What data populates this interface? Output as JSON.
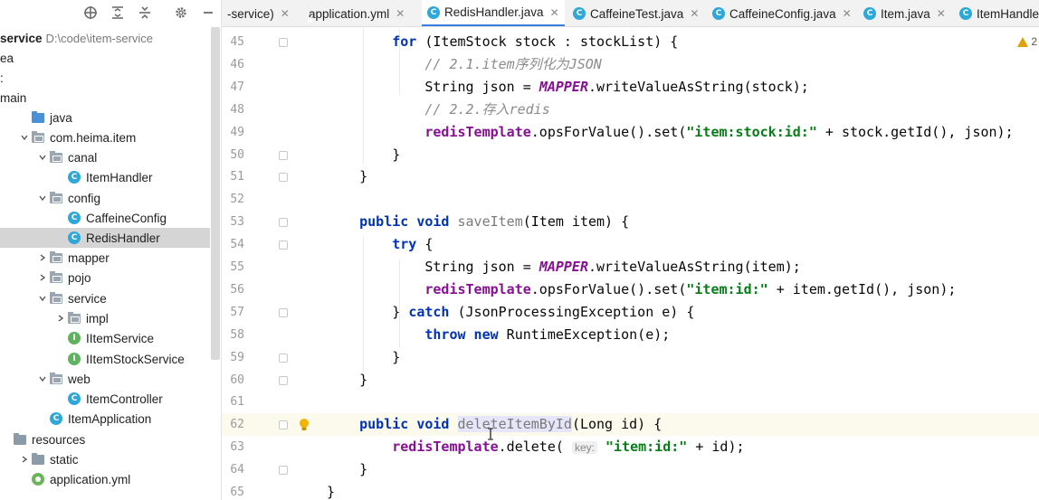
{
  "project": {
    "toolbar_icons": [
      "crosshair-icon",
      "expand-all-icon",
      "collapse-all-icon",
      "gear-icon",
      "hide-icon"
    ],
    "tree": [
      {
        "label": "service",
        "detail": "D:\\code\\item-service",
        "type": "module",
        "indent": 0
      },
      {
        "label": "ea",
        "type": "folder",
        "indent": 0
      },
      {
        "label": ":",
        "type": "text",
        "indent": 0
      },
      {
        "label": "main",
        "type": "folder",
        "indent": 0
      },
      {
        "label": "java",
        "type": "source",
        "indent": 1
      },
      {
        "label": "com.heima.item",
        "type": "package",
        "indent": 1,
        "expanded": true
      },
      {
        "label": "canal",
        "type": "package",
        "indent": 2,
        "expanded": true
      },
      {
        "label": "ItemHandler",
        "type": "class",
        "indent": 3
      },
      {
        "label": "config",
        "type": "package",
        "indent": 2,
        "expanded": true
      },
      {
        "label": "CaffeineConfig",
        "type": "class",
        "indent": 3
      },
      {
        "label": "RedisHandler",
        "type": "class",
        "indent": 3,
        "selected": true
      },
      {
        "label": "mapper",
        "type": "package",
        "indent": 2,
        "expanded": false
      },
      {
        "label": "pojo",
        "type": "package",
        "indent": 2,
        "expanded": false
      },
      {
        "label": "service",
        "type": "package",
        "indent": 2,
        "expanded": true
      },
      {
        "label": "impl",
        "type": "package",
        "indent": 3,
        "expanded": false
      },
      {
        "label": "IItemService",
        "type": "interface",
        "indent": 3
      },
      {
        "label": "IItemStockService",
        "type": "interface",
        "indent": 3
      },
      {
        "label": "web",
        "type": "package",
        "indent": 2,
        "expanded": true
      },
      {
        "label": "ItemController",
        "type": "class",
        "indent": 3
      },
      {
        "label": "ItemApplication",
        "type": "app",
        "indent": 2
      },
      {
        "label": "resources",
        "type": "resources",
        "indent": 0
      },
      {
        "label": "static",
        "type": "folder",
        "indent": 1,
        "expanded": false
      },
      {
        "label": "application.yml",
        "type": "yml",
        "indent": 1
      }
    ]
  },
  "tabs": [
    {
      "label": "-service)",
      "type": "none"
    },
    {
      "label": "application.yml",
      "type": "yml"
    },
    {
      "label": "RedisHandler.java",
      "type": "class",
      "active": true
    },
    {
      "label": "CaffeineTest.java",
      "type": "test"
    },
    {
      "label": "CaffeineConfig.java",
      "type": "class"
    },
    {
      "label": "Item.java",
      "type": "class"
    },
    {
      "label": "ItemHandle",
      "type": "class"
    }
  ],
  "editor": {
    "warning_count": "2",
    "current_line": 62,
    "lines": [
      {
        "num": "45",
        "tokens": [
          [
            "",
            "        "
          ],
          [
            "kw",
            "for"
          ],
          [
            "",
            " (ItemStock stock : stockList) {"
          ]
        ]
      },
      {
        "num": "46",
        "tokens": [
          [
            "",
            "            "
          ],
          [
            "cmt",
            "// 2.1.item序列化为JSON"
          ]
        ]
      },
      {
        "num": "47",
        "tokens": [
          [
            "",
            "            String json = "
          ],
          [
            "const",
            "MAPPER"
          ],
          [
            "",
            ".writeValueAsString(stock);"
          ]
        ]
      },
      {
        "num": "48",
        "tokens": [
          [
            "",
            "            "
          ],
          [
            "cmt",
            "// 2.2.存入redis"
          ]
        ]
      },
      {
        "num": "49",
        "tokens": [
          [
            "",
            "            "
          ],
          [
            "fld",
            "redisTemplate"
          ],
          [
            "",
            ".opsForValue().set("
          ],
          [
            "str",
            "\"item:stock:id:\""
          ],
          [
            "",
            " + stock.getId(), json);"
          ]
        ]
      },
      {
        "num": "50",
        "tokens": [
          [
            "",
            "        }"
          ]
        ]
      },
      {
        "num": "51",
        "tokens": [
          [
            "",
            "    }"
          ]
        ]
      },
      {
        "num": "52",
        "tokens": []
      },
      {
        "num": "53",
        "tokens": [
          [
            "",
            "    "
          ],
          [
            "kw",
            "public void"
          ],
          [
            "",
            " "
          ],
          [
            "unused",
            "saveItem"
          ],
          [
            "",
            "(Item item) {"
          ]
        ]
      },
      {
        "num": "54",
        "tokens": [
          [
            "",
            "        "
          ],
          [
            "kw",
            "try"
          ],
          [
            "",
            " {"
          ]
        ]
      },
      {
        "num": "55",
        "tokens": [
          [
            "",
            "            String json = "
          ],
          [
            "const",
            "MAPPER"
          ],
          [
            "",
            ".writeValueAsString(item);"
          ]
        ]
      },
      {
        "num": "56",
        "tokens": [
          [
            "",
            "            "
          ],
          [
            "fld",
            "redisTemplate"
          ],
          [
            "",
            ".opsForValue().set("
          ],
          [
            "str",
            "\"item:id:\""
          ],
          [
            "",
            " + item.getId(), json);"
          ]
        ]
      },
      {
        "num": "57",
        "tokens": [
          [
            "",
            "        } "
          ],
          [
            "kw",
            "catch"
          ],
          [
            "",
            " (JsonProcessingException e) {"
          ]
        ]
      },
      {
        "num": "58",
        "tokens": [
          [
            "",
            "            "
          ],
          [
            "kw",
            "throw new"
          ],
          [
            "",
            " RuntimeException(e);"
          ]
        ]
      },
      {
        "num": "59",
        "tokens": [
          [
            "",
            "        }"
          ]
        ]
      },
      {
        "num": "60",
        "tokens": [
          [
            "",
            "    }"
          ]
        ]
      },
      {
        "num": "61",
        "tokens": []
      },
      {
        "num": "62",
        "tokens": [
          [
            "",
            "    "
          ],
          [
            "kw",
            "public void"
          ],
          [
            "",
            " "
          ],
          [
            "unused-hl",
            "deleteItemById"
          ],
          [
            "",
            "(Long id) {"
          ]
        ]
      },
      {
        "num": "63",
        "tokens": [
          [
            "",
            "        "
          ],
          [
            "fld",
            "redisTemplate"
          ],
          [
            "",
            ".delete( "
          ],
          [
            "hint",
            "key:"
          ],
          [
            "",
            " "
          ],
          [
            "str",
            "\"item:id:\""
          ],
          [
            "",
            " + id);"
          ]
        ]
      },
      {
        "num": "64",
        "tokens": [
          [
            "",
            "    }"
          ]
        ]
      },
      {
        "num": "65",
        "tokens": [
          [
            "",
            "}"
          ]
        ]
      }
    ]
  }
}
